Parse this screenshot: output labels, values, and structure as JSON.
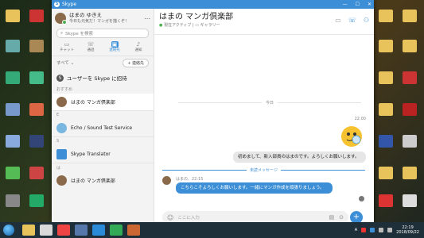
{
  "window": {
    "app_title": "Skype",
    "controls": [
      "—",
      "☐",
      "✕"
    ]
  },
  "profile": {
    "name": "はまの ゆきえ",
    "status": "今日も元気だ！マンガを描くぞ！"
  },
  "search": {
    "placeholder": "Skype を検索"
  },
  "nav": [
    {
      "label": "チャット",
      "icon": "chat-icon"
    },
    {
      "label": "通話",
      "icon": "phone-icon"
    },
    {
      "label": "連絡先",
      "icon": "contacts-icon"
    },
    {
      "label": "通知",
      "icon": "bell-icon"
    }
  ],
  "list": {
    "filter": "すべて ⌄",
    "new_conversation": "+ 連絡先",
    "invite": "ユーザーを Skype に招待",
    "section_recommended": "おすすめ",
    "section_e": "E",
    "section_s": "S",
    "section_ha": "は",
    "contacts": [
      "はまの マンガ倶楽部",
      "Echo / Sound Test Service",
      "Skype Translator",
      "はまの マンガ倶楽部"
    ]
  },
  "chat": {
    "title": "はまの マンガ倶楽部",
    "status": "現在アクティブ",
    "gallery": "ギャラリー",
    "day_label": "今日",
    "time_out": "22:00",
    "message_out": "初めまして、新入部員のはまのです。よろしくお願いします。",
    "unread_label": "未読メッセージ",
    "incoming_meta": "はまの、22:15",
    "message_in": "こちらこそよろしくお願いします。一緒にマンガ作成を頑張りましょう。",
    "composer_placeholder": "ここに入力"
  },
  "taskbar": {
    "time": "22:19",
    "date": "2018/09/22",
    "lang": "A"
  },
  "colors": {
    "accent": "#3c8fd6",
    "online": "#4caf50"
  }
}
